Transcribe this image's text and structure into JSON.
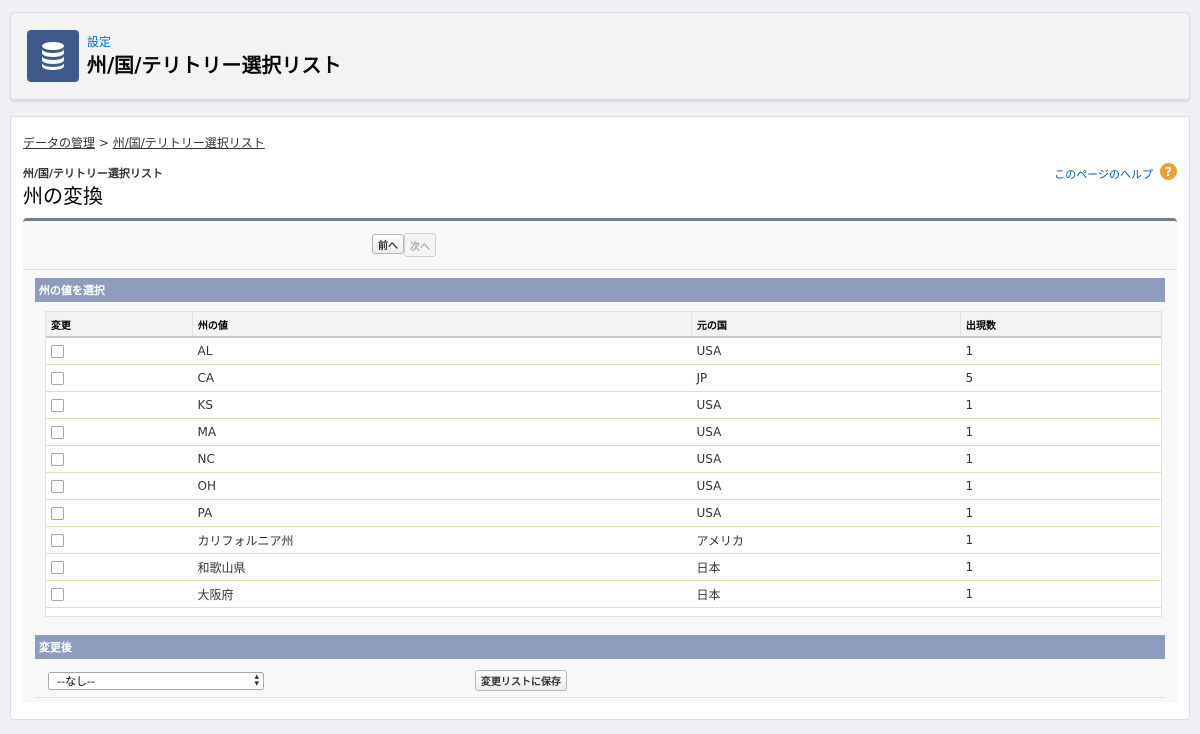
{
  "header": {
    "kicker": "設定",
    "title": "州/国/テリトリー選択リスト",
    "icon": "database-icon",
    "icon_bg": "#3e5a8a"
  },
  "breadcrumb": {
    "root": "データの管理",
    "separator": " > ",
    "current": "州/国/テリトリー選択リスト"
  },
  "page": {
    "subtitle": "州/国/テリトリー選択リスト",
    "title": "州の変換",
    "help_label": "このページのヘルプ",
    "help_icon": "?"
  },
  "nav": {
    "prev_label": "前へ",
    "next_label": "次へ"
  },
  "select_section": {
    "title": "州の値を選択",
    "columns": [
      "変更",
      "州の値",
      "元の国",
      "出現数"
    ],
    "rows": [
      {
        "state": "AL",
        "country": "USA",
        "count": "1"
      },
      {
        "state": "CA",
        "country": "JP",
        "count": "5"
      },
      {
        "state": "KS",
        "country": "USA",
        "count": "1"
      },
      {
        "state": "MA",
        "country": "USA",
        "count": "1"
      },
      {
        "state": "NC",
        "country": "USA",
        "count": "1"
      },
      {
        "state": "OH",
        "country": "USA",
        "count": "1"
      },
      {
        "state": "PA",
        "country": "USA",
        "count": "1"
      },
      {
        "state": "カリフォルニア州",
        "country": "アメリカ",
        "count": "1"
      },
      {
        "state": "和歌山県",
        "country": "日本",
        "count": "1"
      },
      {
        "state": "大阪府",
        "country": "日本",
        "count": "1"
      }
    ]
  },
  "after_section": {
    "title": "変更後",
    "select_value": "--なし--",
    "save_label": "変更リストに保存"
  },
  "colors": {
    "section_header": "#8e9dbd",
    "link": "#015ba7",
    "help_icon": "#e8a23a"
  }
}
